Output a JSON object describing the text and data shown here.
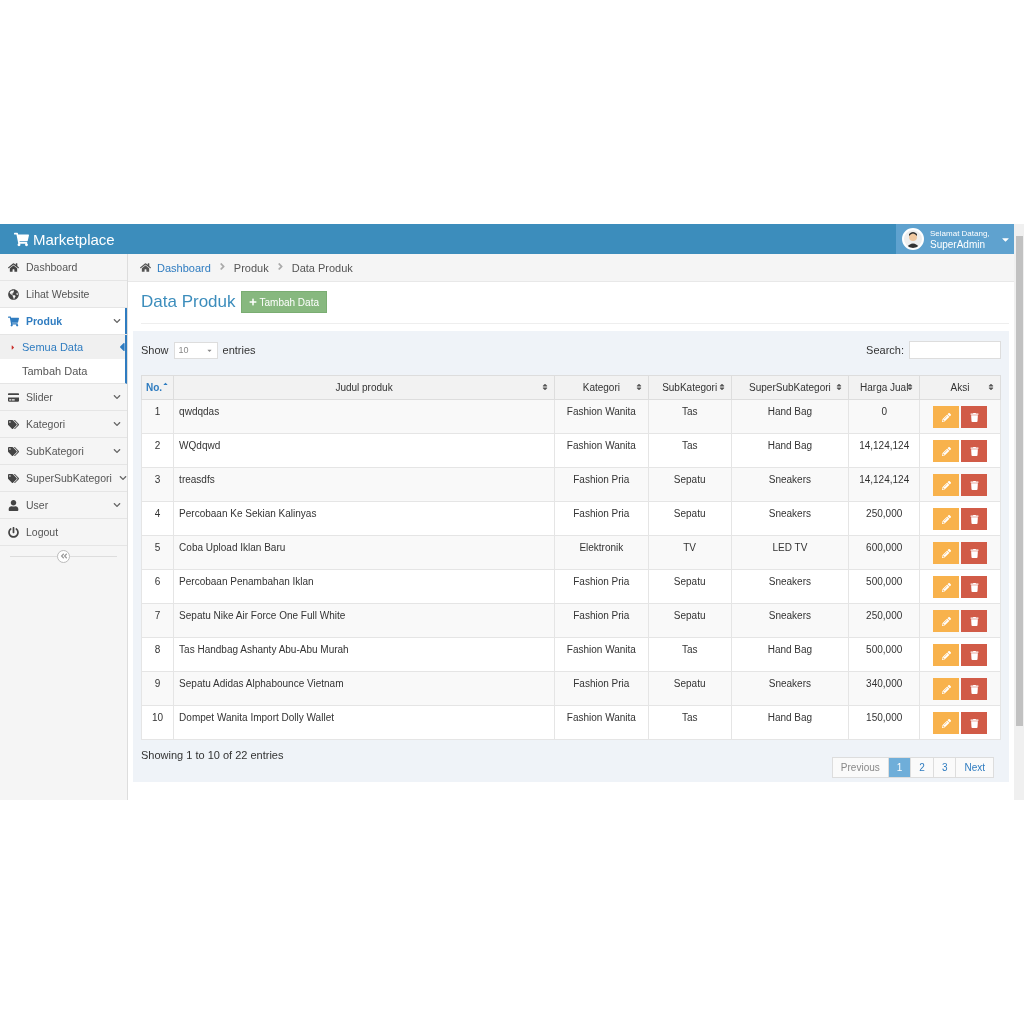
{
  "header": {
    "brand": "Marketplace",
    "user": {
      "greeting": "Selamat Datang,",
      "name": "SuperAdmin"
    }
  },
  "sidebar": {
    "items": [
      {
        "label": "Dashboard",
        "selected": false,
        "has_submenu": false
      },
      {
        "label": "Lihat Website",
        "selected": false,
        "has_submenu": false
      },
      {
        "label": "Produk",
        "selected": true,
        "has_submenu": true,
        "children": [
          {
            "label": "Semua Data",
            "selected": true
          },
          {
            "label": "Tambah Data",
            "selected": false
          }
        ]
      },
      {
        "label": "Slider",
        "selected": false,
        "has_submenu": true
      },
      {
        "label": "Kategori",
        "selected": false,
        "has_submenu": true
      },
      {
        "label": "SubKategori",
        "selected": false,
        "has_submenu": true
      },
      {
        "label": "SuperSubKategori",
        "selected": false,
        "has_submenu": true
      },
      {
        "label": "User",
        "selected": false,
        "has_submenu": true
      },
      {
        "label": "Logout",
        "selected": false,
        "has_submenu": false
      }
    ]
  },
  "breadcrumb": [
    {
      "label": "Dashboard",
      "link": true
    },
    {
      "label": "Produk",
      "link": false
    },
    {
      "label": "Data Produk",
      "link": false
    }
  ],
  "page_title": "Data Produk",
  "add_button": "Tambah Data",
  "length_menu": {
    "before": "Show",
    "value": "10",
    "after": "entries"
  },
  "search": {
    "label": "Search:"
  },
  "table": {
    "columns": [
      {
        "label": "No.",
        "sorted": true
      },
      {
        "label": "Judul produk",
        "sorted": false
      },
      {
        "label": "Kategori",
        "sorted": false
      },
      {
        "label": "SubKategori",
        "sorted": false
      },
      {
        "label": "SuperSubKategori",
        "sorted": false
      },
      {
        "label": "Harga Jual",
        "sorted": false
      },
      {
        "label": "Aksi",
        "sorted": false
      }
    ],
    "rows": [
      [
        "1",
        "qwdqdas",
        "Fashion Wanita",
        "Tas",
        "Hand Bag",
        "0"
      ],
      [
        "2",
        "WQdqwd",
        "Fashion Wanita",
        "Tas",
        "Hand Bag",
        "14,124,124"
      ],
      [
        "3",
        "treasdfs",
        "Fashion Pria",
        "Sepatu",
        "Sneakers",
        "14,124,124"
      ],
      [
        "4",
        "Percobaan Ke Sekian Kalinyas",
        "Fashion Pria",
        "Sepatu",
        "Sneakers",
        "250,000"
      ],
      [
        "5",
        "Coba Upload Iklan Baru",
        "Elektronik",
        "TV",
        "LED TV",
        "600,000"
      ],
      [
        "6",
        "Percobaan Penambahan Iklan",
        "Fashion Pria",
        "Sepatu",
        "Sneakers",
        "500,000"
      ],
      [
        "7",
        "Sepatu Nike Air Force One Full White",
        "Fashion Pria",
        "Sepatu",
        "Sneakers",
        "250,000"
      ],
      [
        "8",
        "Tas Handbag Ashanty Abu-Abu Murah",
        "Fashion Wanita",
        "Tas",
        "Hand Bag",
        "500,000"
      ],
      [
        "9",
        "Sepatu Adidas Alphabounce Vietnam",
        "Fashion Pria",
        "Sepatu",
        "Sneakers",
        "340,000"
      ],
      [
        "10",
        "Dompet Wanita Import Dolly Wallet",
        "Fashion Wanita",
        "Tas",
        "Hand Bag",
        "150,000"
      ]
    ]
  },
  "info": "Showing 1 to 10 of 22 entries",
  "pagination": [
    {
      "label": "Previous",
      "selected": false,
      "disabled": true
    },
    {
      "label": "1",
      "selected": true,
      "disabled": false
    },
    {
      "label": "2",
      "selected": false,
      "disabled": false
    },
    {
      "label": "3",
      "selected": false,
      "disabled": false
    },
    {
      "label": "Next",
      "selected": false,
      "disabled": false
    }
  ]
}
